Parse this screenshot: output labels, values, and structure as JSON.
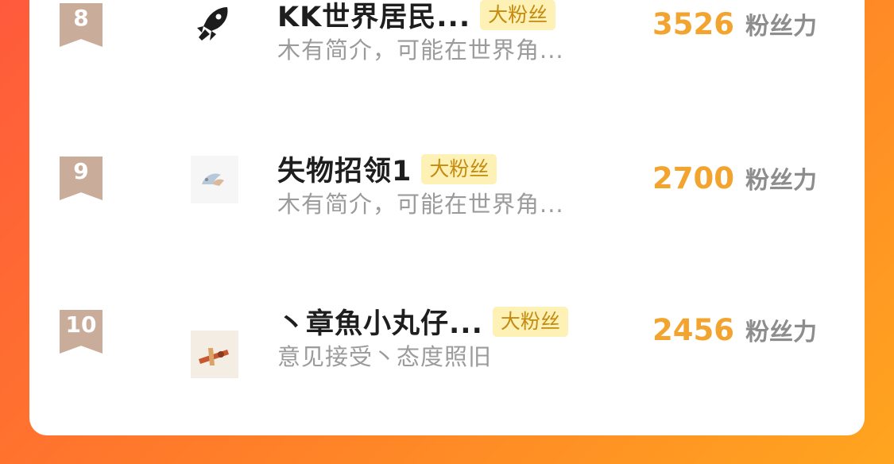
{
  "leaderboard": {
    "rows": [
      {
        "rank": "8",
        "name": "KK世界居民...",
        "badge": "大粉丝",
        "description": "木有简介，可能在世界角...",
        "score": "3526",
        "score_label": "粉丝力",
        "avatar_icon": "rocket-icon"
      },
      {
        "rank": "9",
        "name": "失物招领1",
        "badge": "大粉丝",
        "description": "木有简介，可能在世界角...",
        "score": "2700",
        "score_label": "粉丝力",
        "avatar_icon": "bird-icon"
      },
      {
        "rank": "10",
        "name": "丶章魚小丸仔...",
        "badge": "大粉丝",
        "description": "意见接受丶态度照旧",
        "score": "2456",
        "score_label": "粉丝力",
        "avatar_icon": "illustration-icon"
      }
    ]
  },
  "colors": {
    "background_start": "#ff5a3c",
    "background_end": "#ffa51f",
    "rank_badge": "#c9ad9a",
    "score": "#f2a42f",
    "fan_badge_bg": "#fdf1b5",
    "fan_badge_text": "#c58a10"
  }
}
